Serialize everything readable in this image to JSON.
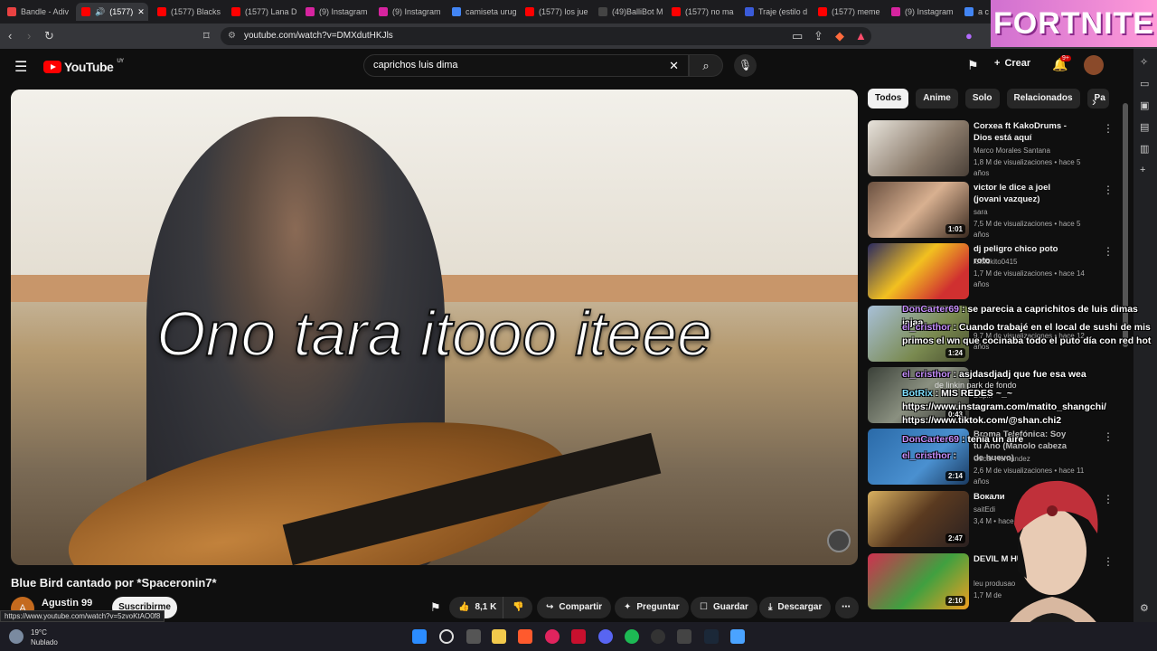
{
  "browser": {
    "tabs": [
      {
        "label": "Bandle - Adiv",
        "color": "#e94242"
      },
      {
        "label": "(1577)",
        "color": "#ff0000",
        "active": true
      },
      {
        "label": "(1577) Blacks",
        "color": "#ff0000"
      },
      {
        "label": "(1577) Lana D",
        "color": "#ff0000"
      },
      {
        "label": "(9) Instagram",
        "color": "#d6249f"
      },
      {
        "label": "(9) Instagram",
        "color": "#d6249f"
      },
      {
        "label": "camiseta urug",
        "color": "#4285f4"
      },
      {
        "label": "(1577) los jue",
        "color": "#ff0000"
      },
      {
        "label": "(49)BalliBot M",
        "color": "#111111"
      },
      {
        "label": "(1577) no ma",
        "color": "#ff0000"
      },
      {
        "label": "Traje (estilo d",
        "color": "#3a5bd9"
      },
      {
        "label": "(1577) meme",
        "color": "#ff0000"
      },
      {
        "label": "(9) Instagram",
        "color": "#d6249f"
      },
      {
        "label": "a c",
        "color": "#4285f4"
      }
    ],
    "url": "youtube.com/watch?v=DMXdutHKJls"
  },
  "overlay": {
    "fortnite": "FORTNITE"
  },
  "youtube": {
    "logo": "YouTube",
    "country": "UY",
    "search_value": "caprichos luis dima",
    "create_label": "Crear",
    "notif_count": "9+",
    "video": {
      "caption": "Ono tara itooo iteee",
      "title": "Blue Bird cantado por *Spaceronin7*",
      "channel": "Agustin 99",
      "channel_initial": "A",
      "subscribe": "Suscribirme",
      "likes": "8,1 K",
      "share": "Compartir",
      "ask": "Preguntar",
      "save": "Guardar",
      "download": "Descargar"
    },
    "chips": [
      "Todos",
      "Anime",
      "Solo",
      "Relacionados",
      "Pa"
    ],
    "recs": [
      {
        "title": "Corxea ft KakoDrums - Dios está aquí",
        "channel": "Marco Morales Santana",
        "meta": "1,8 M de visualizaciones • hace 5 años",
        "duration": ""
      },
      {
        "title": "victor le dice a joel (jovani vazquez)",
        "channel": "sara",
        "meta": "7,5 M de visualizaciones • hace 5 años",
        "duration": "1:01"
      },
      {
        "title": "dj peligro chico poto roto",
        "channel": "lokilokito0415",
        "meta": "1,7 M de visualizaciones • hace 14 años",
        "duration": ""
      },
      {
        "title": "",
        "channel": "",
        "meta": "9,7 M de visualizaciones • hace 12 años",
        "duration": "1:24"
      },
      {
        "title": "",
        "channel": "Dupin",
        "meta": "",
        "duration": "0:43"
      },
      {
        "title": "Broma Telefónica: Soy tu Ano (Manolo cabeza de huevo)",
        "channel": "Oscar Hernandez",
        "meta": "2,6 M de visualizaciones • hace 11 años",
        "duration": "2:14"
      },
      {
        "title": "Вокали",
        "channel": "saitEdi",
        "meta": "3,4 M • hace 16 años",
        "duration": "2:47"
      },
      {
        "title": "DEVIL M HUMANO",
        "channel": "leu produsao",
        "meta": "1,7 M de",
        "duration": "2:10"
      }
    ]
  },
  "chat": [
    {
      "user": "DonCarter69",
      "text": ": se parecia a caprichitos de luis dimas jajaa"
    },
    {
      "user": "el_cristhor",
      "text": ": Cuando trabajé en el local de sushi de mis primos el wn que cocinaba todo el puto día con red hot"
    },
    {
      "user": "el_cristhor",
      "text": ": asjdasdjadj que fue esa wea"
    },
    {
      "user": "BotRix",
      "text": ": MIS REDES ~_~ https://www.instagram.com/matito_shangchi/ https://www.tiktok.com/@shan.chi2"
    },
    {
      "user": "DonCarter69",
      "text": ": tenia un aire"
    },
    {
      "user": "el_cristhor",
      "text": ":"
    }
  ],
  "linkpark": "de linkin park de fondo",
  "status_url": "https://www.youtube.com/watch?v=5zvoKtAO0f8",
  "taskbar": {
    "temp": "19°C",
    "weather": "Nublado"
  }
}
